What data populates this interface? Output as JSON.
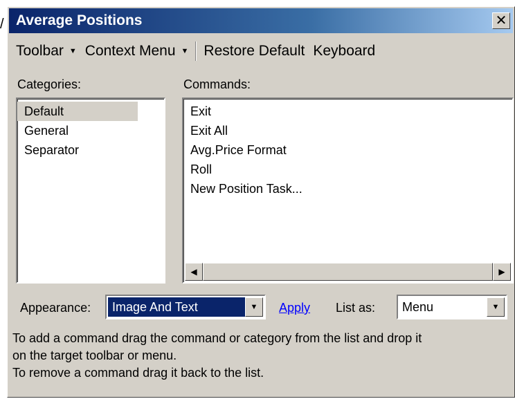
{
  "window": {
    "title": "Average Positions"
  },
  "menubar": {
    "toolbar": "Toolbar",
    "context_menu": "Context Menu",
    "restore_default": "Restore Default",
    "keyboard": "Keyboard"
  },
  "categories": {
    "label": "Categories:",
    "items": [
      "Default",
      "General",
      "Separator"
    ],
    "selected": "Default"
  },
  "commands": {
    "label": "Commands:",
    "items": [
      "Exit",
      "Exit All",
      "Avg.Price Format",
      "Roll",
      "New Position Task..."
    ]
  },
  "appearance": {
    "label": "Appearance:",
    "value": "Image And Text"
  },
  "apply_label": "Apply",
  "list_as": {
    "label": "List as:",
    "value": "Menu"
  },
  "help": {
    "line1": "To add a command drag the command or category from the list and drop it",
    "line2": "on the target toolbar or menu.",
    "line3": "To remove a command drag it back to the list."
  },
  "icons": {
    "close": "close-icon",
    "dropdown": "dropdown-arrow-icon",
    "scroll_left": "scroll-left-icon",
    "scroll_right": "scroll-right-icon"
  },
  "colors": {
    "title_start": "#0a246a",
    "title_end": "#a6caf0",
    "face": "#d4d0c8",
    "selection": "#0a246a",
    "link": "#0000ff"
  }
}
